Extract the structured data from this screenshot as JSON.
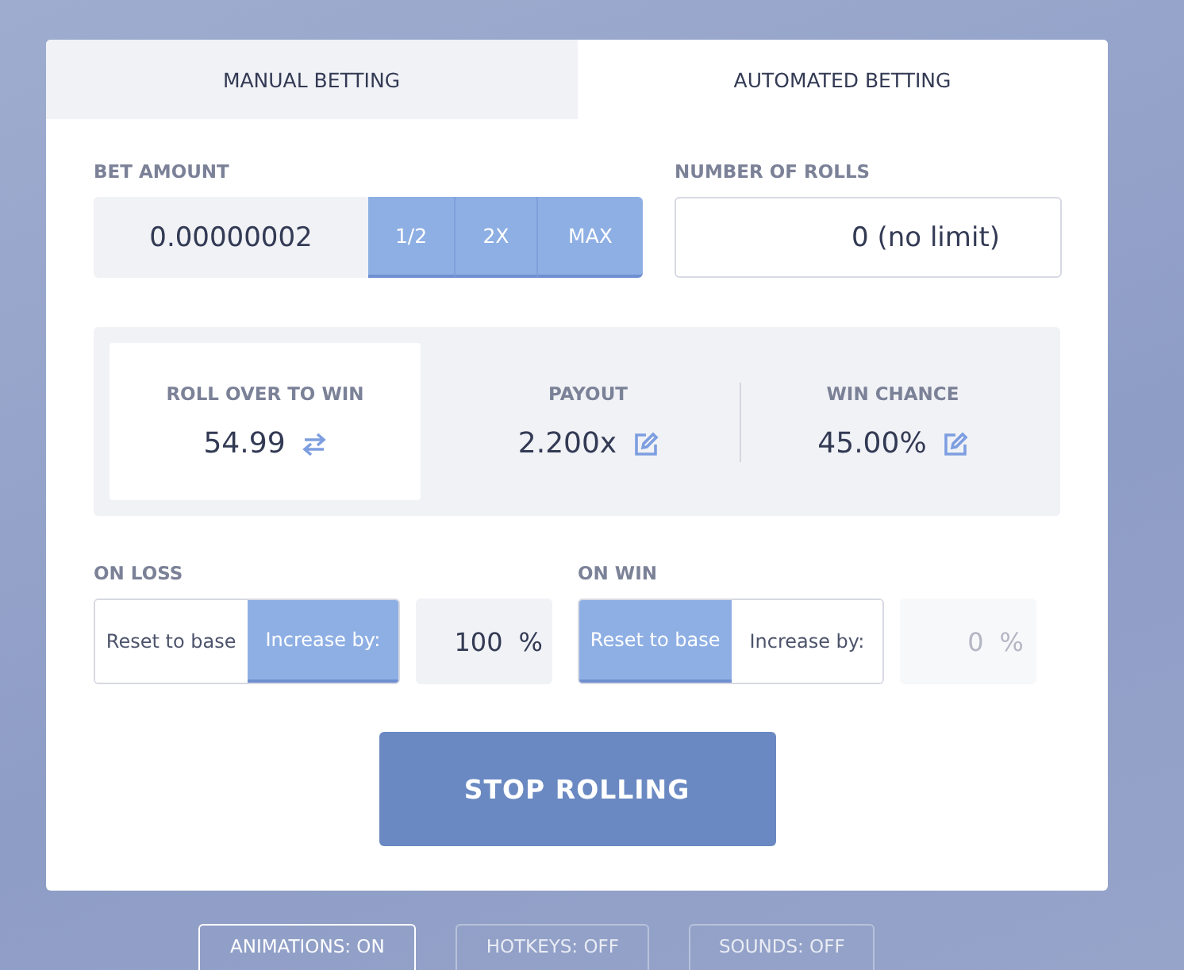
{
  "tabs": [
    {
      "label": "MANUAL BETTING",
      "selected": false
    },
    {
      "label": "AUTOMATED BETTING",
      "selected": true
    }
  ],
  "bet_amount": {
    "label": "BET AMOUNT",
    "value": "0.00000002",
    "buttons": [
      "1/2",
      "2X",
      "MAX"
    ]
  },
  "number_of_rolls": {
    "label": "NUMBER OF ROLLS",
    "value": "0 (no limit)"
  },
  "stats": [
    {
      "label": "ROLL OVER TO WIN",
      "value": "54.99",
      "kind": "swap",
      "selected": true
    },
    {
      "label": "PAYOUT",
      "value": "2.200x",
      "kind": "edit",
      "selected": false
    },
    {
      "label": "WIN CHANCE",
      "value": "45.00%",
      "kind": "edit",
      "selected": false
    }
  ],
  "strategies": [
    {
      "label": "ON LOSS",
      "options": [
        {
          "label": "Reset to base",
          "selected": false
        },
        {
          "label": "Increase by:",
          "selected": true
        }
      ],
      "value": "100",
      "unit": "%",
      "disabled": false
    },
    {
      "label": "ON WIN",
      "options": [
        {
          "label": "Reset to base",
          "selected": true
        },
        {
          "label": "Increase by:",
          "selected": false
        }
      ],
      "value": "0",
      "unit": "%",
      "disabled": true
    }
  ],
  "action_button": "STOP ROLLING",
  "toggles": [
    {
      "label": "ANIMATIONS: ON",
      "on": true
    },
    {
      "label": "HOTKEYS: OFF",
      "on": false
    },
    {
      "label": "SOUNDS: OFF",
      "on": false
    }
  ]
}
